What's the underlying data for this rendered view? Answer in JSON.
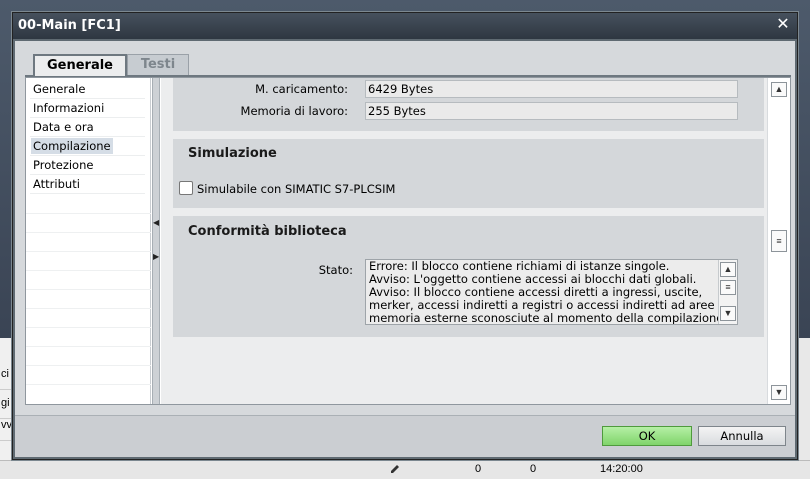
{
  "background": {
    "left_rows": [
      "ci",
      "gi",
      "vv"
    ],
    "status": {
      "col1": "0",
      "col2": "0",
      "time": "14:20:00"
    }
  },
  "window": {
    "title": "00-Main [FC1]",
    "close_label": "✕"
  },
  "tabs": [
    {
      "label": "Generale",
      "active": true
    },
    {
      "label": "Testi",
      "active": false
    }
  ],
  "nav": {
    "items": [
      {
        "label": "Generale"
      },
      {
        "label": "Informazioni"
      },
      {
        "label": "Data e ora"
      },
      {
        "label": "Compilazione",
        "selected": true
      },
      {
        "label": "Protezione"
      },
      {
        "label": "Attributi"
      }
    ]
  },
  "compilazione": {
    "load_memory_label": "M. caricamento:",
    "load_memory_value": "6429 Bytes",
    "work_memory_label": "Memoria di lavoro:",
    "work_memory_value": "255 Bytes"
  },
  "simulazione": {
    "title": "Simulazione",
    "checkbox_label": "Simulabile con SIMATIC S7-PLCSIM",
    "checked": false
  },
  "conformita": {
    "title": "Conformità biblioteca",
    "stato_label": "Stato:",
    "stato_lines": [
      "Errore: Il blocco contiene richiami di istanze singole.",
      "Avviso: L'oggetto contiene accessi ai blocchi dati globali.",
      "Avviso: Il blocco contiene accessi diretti a ingressi, uscite,",
      "merker, accessi indiretti a registri o accessi indiretti ad aree di",
      "memoria esterne sconosciute al momento della compilazione"
    ]
  },
  "footer": {
    "ok_label": "OK",
    "cancel_label": "Annulla"
  },
  "colors": {
    "ok_button": "#8fdc7c",
    "title_bar": "#38424d",
    "section_bg": "#d4d7da"
  }
}
